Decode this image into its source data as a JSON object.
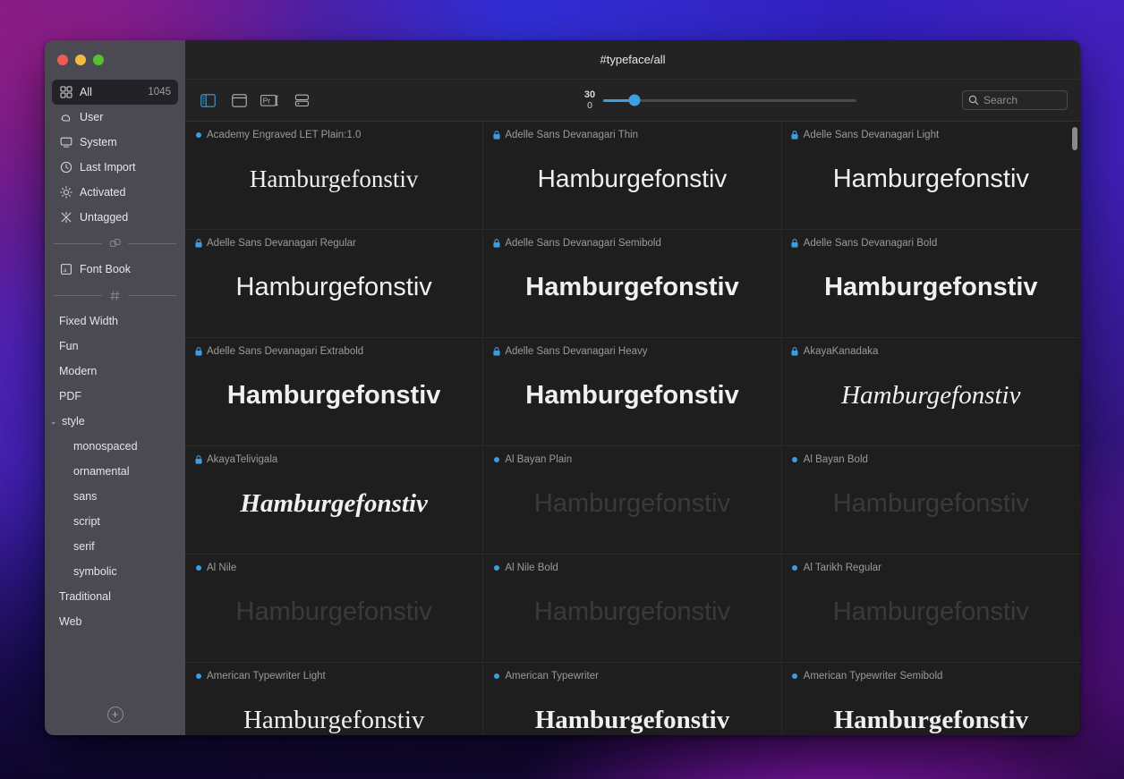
{
  "window": {
    "title": "#typeface/all",
    "traffic_lights": [
      "close",
      "minimize",
      "zoom"
    ]
  },
  "sidebar": {
    "sources": [
      {
        "icon": "grid-icon",
        "label": "All",
        "count": "1045",
        "selected": true
      },
      {
        "icon": "cloud-icon",
        "label": "User",
        "count": "",
        "selected": false
      },
      {
        "icon": "monitor-icon",
        "label": "System",
        "count": "",
        "selected": false
      },
      {
        "icon": "clock-icon",
        "label": "Last Import",
        "count": "",
        "selected": false
      },
      {
        "icon": "sun-icon",
        "label": "Activated",
        "count": "",
        "selected": false
      },
      {
        "icon": "asterisk-icon",
        "label": "Untagged",
        "count": "",
        "selected": false
      }
    ],
    "divider_collections_icon": "collections-icon",
    "collections": [
      {
        "icon": "font-book-icon",
        "label": "Font Book"
      }
    ],
    "divider_tags_icon": "hash-icon",
    "tags": [
      {
        "label": "Fixed Width",
        "level": 0,
        "caret": ""
      },
      {
        "label": "Fun",
        "level": 0,
        "caret": ""
      },
      {
        "label": "Modern",
        "level": 0,
        "caret": ""
      },
      {
        "label": "PDF",
        "level": 0,
        "caret": ""
      },
      {
        "label": "style",
        "level": 0,
        "caret": "⌄"
      },
      {
        "label": "monospaced",
        "level": 1,
        "caret": ""
      },
      {
        "label": "ornamental",
        "level": 1,
        "caret": ""
      },
      {
        "label": "sans",
        "level": 1,
        "caret": ""
      },
      {
        "label": "script",
        "level": 1,
        "caret": ""
      },
      {
        "label": "serif",
        "level": 1,
        "caret": ""
      },
      {
        "label": "symbolic",
        "level": 1,
        "caret": ""
      },
      {
        "label": "Traditional",
        "level": 0,
        "caret": ""
      },
      {
        "label": "Web",
        "level": 0,
        "caret": ""
      }
    ],
    "add_button_label": "+",
    "add_button_name": "add-collection-button"
  },
  "toolbar": {
    "view_modes": [
      {
        "name": "sidebar-toggle-icon",
        "active": true
      },
      {
        "name": "single-pane-icon",
        "active": false
      },
      {
        "name": "preview-text-icon",
        "active": false
      },
      {
        "name": "list-rows-icon",
        "active": false
      }
    ],
    "size_slider": {
      "max_label": "30",
      "min_label": "0",
      "value_percent": 12
    },
    "search": {
      "placeholder": "Search",
      "value": "",
      "icon": "search-icon"
    }
  },
  "accent_color": "#3f9fe0",
  "grid": {
    "sample_text": "Hamburgefonstiv",
    "cards": [
      {
        "name": "Academy Engraved LET Plain:1.0",
        "badge": "dot",
        "style": "s-serif",
        "size": 27,
        "weight": "400",
        "dim": false
      },
      {
        "name": "Adelle Sans Devanagari Thin",
        "badge": "lock",
        "style": "s-sans",
        "size": 28,
        "weight": "300",
        "dim": false
      },
      {
        "name": "Adelle Sans Devanagari Light",
        "badge": "lock",
        "style": "s-sans",
        "size": 29,
        "weight": "400",
        "dim": false
      },
      {
        "name": "Adelle Sans Devanagari Regular",
        "badge": "lock",
        "style": "s-sans",
        "size": 29,
        "weight": "400",
        "dim": false
      },
      {
        "name": "Adelle Sans Devanagari Semibold",
        "badge": "lock",
        "style": "s-sans",
        "size": 29,
        "weight": "700",
        "dim": false
      },
      {
        "name": "Adelle Sans Devanagari Bold",
        "badge": "lock",
        "style": "s-sans",
        "size": 29,
        "weight": "700",
        "dim": false
      },
      {
        "name": "Adelle Sans Devanagari Extrabold",
        "badge": "lock",
        "style": "s-sans",
        "size": 29,
        "weight": "700",
        "dim": false
      },
      {
        "name": "Adelle Sans Devanagari Heavy",
        "badge": "lock",
        "style": "s-sans",
        "size": 29,
        "weight": "700",
        "dim": false
      },
      {
        "name": "AkayaKanadaka",
        "badge": "lock",
        "style": "s-serif-i",
        "size": 29,
        "weight": "400",
        "dim": false
      },
      {
        "name": "AkayaTelivigala",
        "badge": "lock",
        "style": "s-serif-i",
        "size": 29,
        "weight": "700",
        "dim": false
      },
      {
        "name": "Al Bayan Plain",
        "badge": "dot",
        "style": "s-sans",
        "size": 29,
        "weight": "400",
        "dim": true
      },
      {
        "name": "Al Bayan Bold",
        "badge": "dot",
        "style": "s-sans",
        "size": 29,
        "weight": "400",
        "dim": true
      },
      {
        "name": "Al Nile",
        "badge": "dot",
        "style": "s-sans",
        "size": 29,
        "weight": "400",
        "dim": true
      },
      {
        "name": "Al Nile Bold",
        "badge": "dot",
        "style": "s-sans",
        "size": 29,
        "weight": "400",
        "dim": true
      },
      {
        "name": "Al Tarikh Regular",
        "badge": "dot",
        "style": "s-sans",
        "size": 29,
        "weight": "400",
        "dim": true
      },
      {
        "name": "American Typewriter Light",
        "badge": "dot",
        "style": "s-serif",
        "size": 29,
        "weight": "400",
        "dim": false
      },
      {
        "name": "American Typewriter",
        "badge": "dot",
        "style": "s-serif",
        "size": 29,
        "weight": "700",
        "dim": false
      },
      {
        "name": "American Typewriter Semibold",
        "badge": "dot",
        "style": "s-serif",
        "size": 29,
        "weight": "700",
        "dim": false
      }
    ]
  }
}
